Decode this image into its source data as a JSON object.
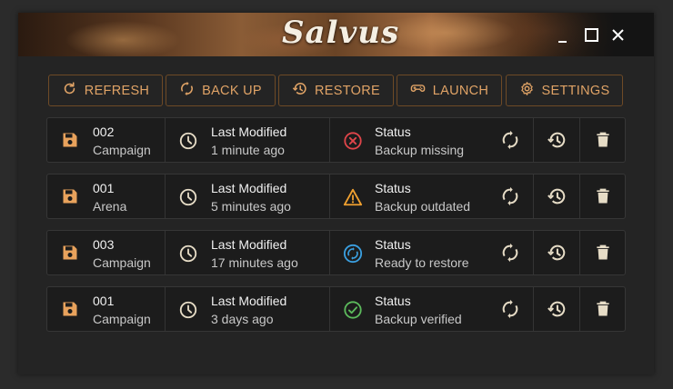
{
  "app": {
    "title": "Salvus"
  },
  "window_controls": {
    "minimize": "minimize-icon",
    "maximize": "maximize-icon",
    "close": "close-icon"
  },
  "toolbar": {
    "refresh": "REFRESH",
    "backup": "BACK UP",
    "restore": "RESTORE",
    "launch": "LAUNCH",
    "settings": "SETTINGS"
  },
  "colors": {
    "accent": "#e0a366",
    "error": "#e0454a",
    "warning": "#f0a030",
    "info": "#3a9fe0",
    "success": "#5cba5c"
  },
  "saves": [
    {
      "slot": "002",
      "mode": "Campaign",
      "modified_label": "Last Modified",
      "modified": "1 minute ago",
      "status_label": "Status",
      "status": "Backup missing",
      "status_icon": "error-x-icon"
    },
    {
      "slot": "001",
      "mode": "Arena",
      "modified_label": "Last Modified",
      "modified": "5 minutes ago",
      "status_label": "Status",
      "status": "Backup outdated",
      "status_icon": "warning-triangle-icon"
    },
    {
      "slot": "003",
      "mode": "Campaign",
      "modified_label": "Last Modified",
      "modified": "17 minutes ago",
      "status_label": "Status",
      "status": "Ready to restore",
      "status_icon": "sync-circle-icon"
    },
    {
      "slot": "001",
      "mode": "Campaign",
      "modified_label": "Last Modified",
      "modified": "3 days ago",
      "status_label": "Status",
      "status": "Backup verified",
      "status_icon": "check-circle-icon"
    }
  ]
}
